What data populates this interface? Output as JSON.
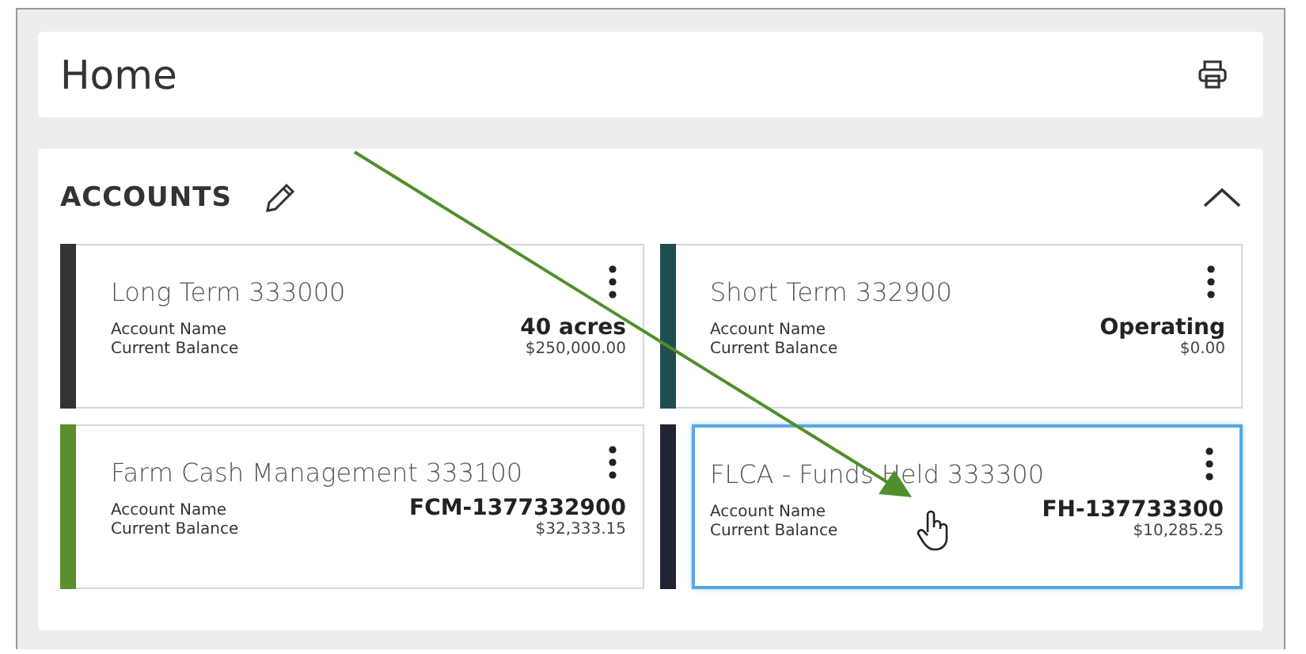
{
  "page": {
    "title": "Home"
  },
  "accounts": {
    "heading": "ACCOUNTS",
    "expanded": true,
    "cards": [
      {
        "title": "Long Term 333000",
        "name_label": "Account Name",
        "name": "40 acres",
        "balance_label": "Current Balance",
        "balance": "$250,000.00",
        "color": "#333333",
        "selected": false
      },
      {
        "title": "Short Term 332900",
        "name_label": "Account Name",
        "name": "Operating",
        "balance_label": "Current Balance",
        "balance": "$0.00",
        "color": "#1f4e52",
        "selected": false
      },
      {
        "title": "Farm Cash Management 333100",
        "name_label": "Account Name",
        "name": "FCM-1377332900",
        "balance_label": "Current Balance",
        "balance": "$32,333.15",
        "color": "#5a8f2e",
        "selected": false
      },
      {
        "title": "FLCA - Funds Held 333300",
        "name_label": "Account Name",
        "name": "FH-137733300",
        "balance_label": "Current Balance",
        "balance": "$10,285.25",
        "color": "#1e2433",
        "selected": true
      }
    ]
  }
}
